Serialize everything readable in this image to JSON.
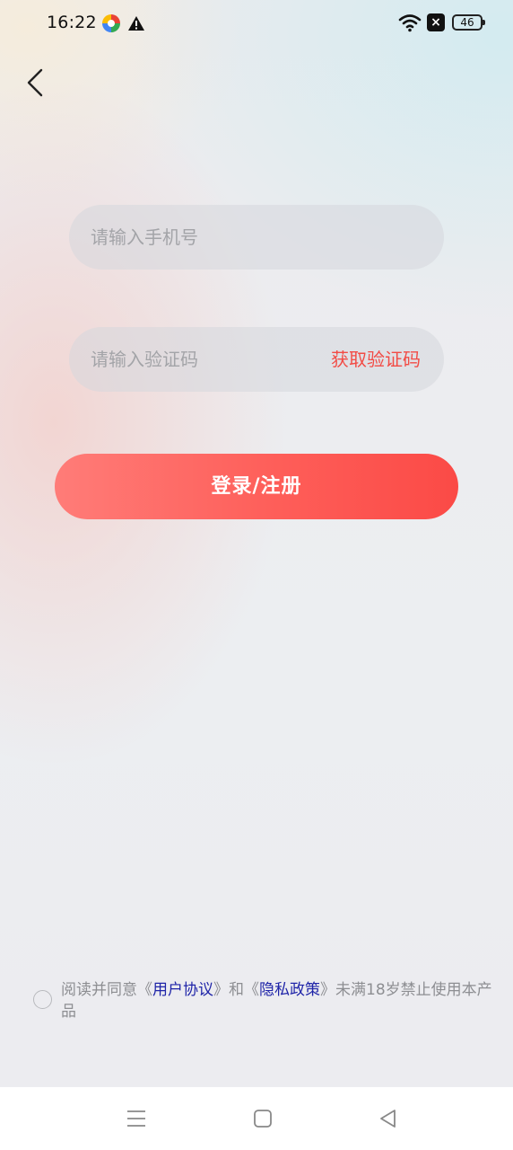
{
  "status_bar": {
    "time": "16:22",
    "battery": "46",
    "sim_icon": "sim-off-icon",
    "notification_icons": [
      "app-notification-icon",
      "warning-icon"
    ]
  },
  "header": {
    "back_icon": "chevron-left-icon"
  },
  "form": {
    "phone_placeholder": "请输入手机号",
    "code_placeholder": "请输入验证码",
    "get_code_label": "获取验证码",
    "submit_label": "登录/注册"
  },
  "agreement": {
    "prefix": "阅读并同意《",
    "user_agreement": "用户协议",
    "middle": "》和《",
    "privacy_policy": "隐私政策",
    "suffix": "》未满18岁禁止使用本产品",
    "checked": false
  },
  "nav_bar": {
    "icons": [
      "menu-icon",
      "home-square-icon",
      "back-triangle-icon"
    ]
  },
  "colors": {
    "accent": "#f24b45",
    "button_gradient_start": "#ff7c78",
    "button_gradient_end": "#fb4a46",
    "link": "#1f24a8",
    "placeholder": "#a3a4a8"
  }
}
